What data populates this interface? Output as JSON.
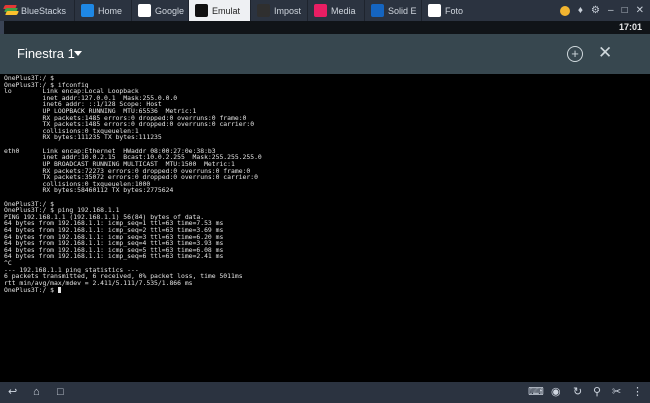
{
  "bluestacks": {
    "brand": "BlueStacks",
    "tabs": [
      {
        "label": "Home",
        "icon": "home-icon",
        "color": "#1e88e5",
        "active": false
      },
      {
        "label": "Google",
        "icon": "play-store-icon",
        "color": "#ffffff",
        "active": false
      },
      {
        "label": "Emulat",
        "icon": "terminal-icon",
        "color": "#111111",
        "active": true
      },
      {
        "label": "Impost",
        "icon": "gear-icon",
        "color": "#2f2f2f",
        "active": false
      },
      {
        "label": "Media",
        "icon": "media-icon",
        "color": "#e91e63",
        "active": false
      },
      {
        "label": "Solid E",
        "icon": "solid-explorer-icon",
        "color": "#1565c0",
        "active": false
      },
      {
        "label": "Foto",
        "icon": "photos-icon",
        "color": "#ffffff",
        "active": false
      }
    ]
  },
  "status": {
    "time": "17:01"
  },
  "app": {
    "title": "Finestra 1"
  },
  "terminal": {
    "lines": [
      "OnePlus3T:/ $",
      "OnePlus3T:/ $ ifconfig",
      "lo        Link encap:Local Loopback",
      "          inet addr:127.0.0.1  Mask:255.0.0.0",
      "          inet6 addr: ::1/128 Scope: Host",
      "          UP LOOPBACK RUNNING  MTU:65536  Metric:1",
      "          RX packets:1485 errors:0 dropped:0 overruns:0 frame:0",
      "          TX packets:1485 errors:0 dropped:0 overruns:0 carrier:0",
      "          collisions:0 txqueuelen:1",
      "          RX bytes:111235 TX bytes:111235",
      "",
      "eth0      Link encap:Ethernet  HWaddr 08:00:27:0e:38:b3",
      "          inet addr:10.0.2.15  Bcast:10.0.2.255  Mask:255.255.255.0",
      "          UP BROADCAST RUNNING MULTICAST  MTU:1500  Metric:1",
      "          RX packets:72273 errors:0 dropped:0 overruns:0 frame:0",
      "          TX packets:35072 errors:0 dropped:0 overruns:0 carrier:0",
      "          collisions:0 txqueuelen:1000",
      "          RX bytes:58460112 TX bytes:2775624",
      "",
      "OnePlus3T:/ $",
      "OnePlus3T:/ $ ping 192.168.1.1",
      "PING 192.168.1.1 (192.168.1.1) 56(84) bytes of data.",
      "64 bytes from 192.168.1.1: icmp_seq=1 ttl=63 time=7.53 ms",
      "64 bytes from 192.168.1.1: icmp_seq=2 ttl=63 time=3.69 ms",
      "64 bytes from 192.168.1.1: icmp_seq=3 ttl=63 time=6.20 ms",
      "64 bytes from 192.168.1.1: icmp_seq=4 ttl=63 time=3.93 ms",
      "64 bytes from 192.168.1.1: icmp_seq=5 ttl=63 time=6.08 ms",
      "64 bytes from 192.168.1.1: icmp_seq=6 ttl=63 time=2.41 ms",
      "^C",
      "--- 192.168.1.1 ping statistics ---",
      "6 packets transmitted, 6 received, 0% packet loss, time 5011ms",
      "rtt min/avg/max/mdev = 2.411/5.111/7.535/1.866 ms",
      "OnePlus3T:/ $ "
    ]
  }
}
